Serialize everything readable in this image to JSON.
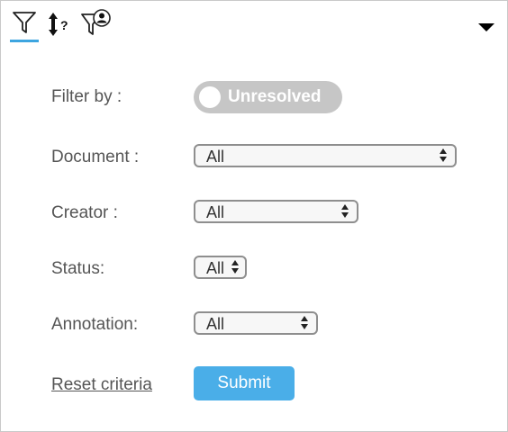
{
  "toolbar": {
    "tabs": [
      {
        "icon": "filter-icon",
        "active": true
      },
      {
        "icon": "sort-icon",
        "active": false
      },
      {
        "icon": "user-filter-icon",
        "active": false
      }
    ],
    "sort_question_mark": "?",
    "collapse_icon": "caret-down-icon",
    "accent_color": "#3da5e0"
  },
  "filters": {
    "filter_by": {
      "label": "Filter by :",
      "toggle_value": "Unresolved",
      "toggle_color": "#c6c6c6"
    },
    "document": {
      "label": "Document :",
      "value": "All"
    },
    "creator": {
      "label": "Creator :",
      "value": "All"
    },
    "status": {
      "label": "Status:",
      "value": "All"
    },
    "annotation": {
      "label": "Annotation:",
      "value": "All"
    }
  },
  "actions": {
    "reset_label": "Reset criteria",
    "submit_label": "Submit",
    "submit_color": "#4aaee8"
  }
}
